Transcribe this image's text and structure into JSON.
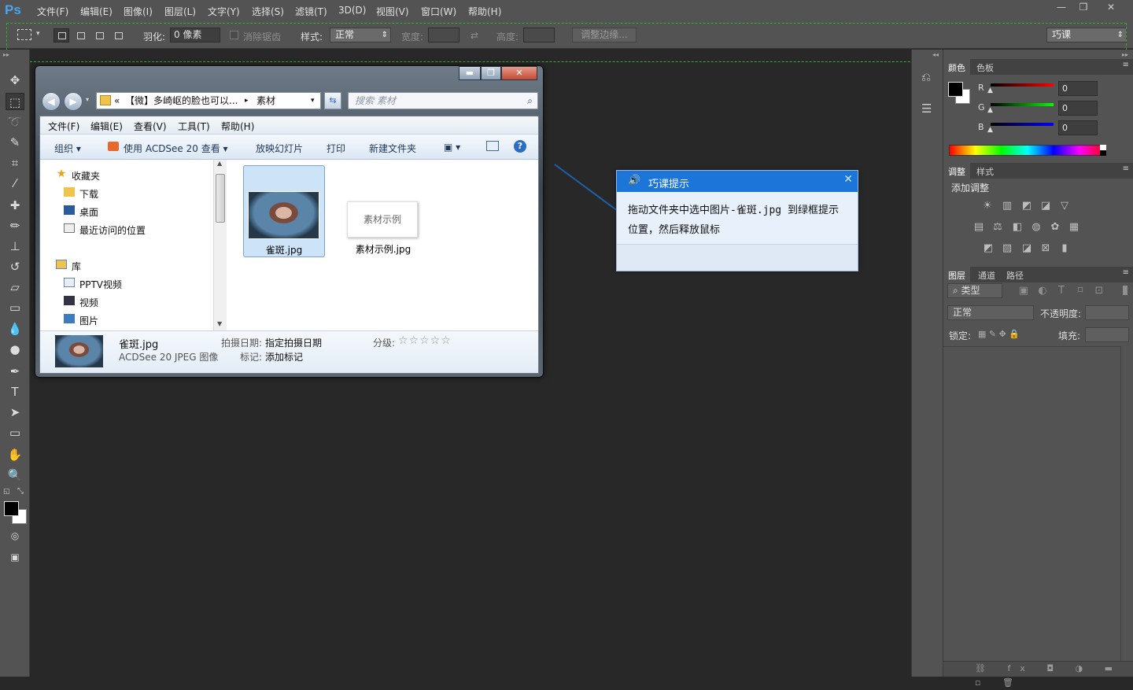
{
  "app": {
    "logo": "Ps"
  },
  "menu": [
    "文件(F)",
    "编辑(E)",
    "图像(I)",
    "图层(L)",
    "文字(Y)",
    "选择(S)",
    "滤镜(T)",
    "3D(D)",
    "视图(V)",
    "窗口(W)",
    "帮助(H)"
  ],
  "options": {
    "feather_label": "羽化:",
    "feather_value": "0 像素",
    "antialias_label": "消除锯齿",
    "style_label": "样式:",
    "style_value": "正常",
    "width_label": "宽度:",
    "height_label": "高度:",
    "refine_edge": "调整边缘...",
    "workspace": "巧课"
  },
  "explorer": {
    "address_prefix": "«",
    "address_path": "【微】多崎岖的脸也可以...",
    "address_sep": "▸",
    "address_current": "素材",
    "search_placeholder": "搜索 素材",
    "menu": [
      "文件(F)",
      "编辑(E)",
      "查看(V)",
      "工具(T)",
      "帮助(H)"
    ],
    "commands": {
      "organize": "组织 ▾",
      "open_with": "使用 ACDSee 20 查看 ▾",
      "slideshow": "放映幻灯片",
      "print": "打印",
      "new_folder": "新建文件夹"
    },
    "nav": {
      "favorites": "收藏夹",
      "downloads": "下载",
      "desktop": "桌面",
      "recent": "最近访问的位置",
      "libraries": "库",
      "pptv": "PPTV视频",
      "videos": "视频",
      "pictures": "图片"
    },
    "files": [
      {
        "name": "雀斑.jpg"
      },
      {
        "name": "素材示例.jpg",
        "thumb_text": "素材示例"
      }
    ],
    "details": {
      "filename": "雀斑.jpg",
      "filetype": "ACDSee 20 JPEG 图像",
      "date_label": "拍摄日期:",
      "date_value": "指定拍摄日期",
      "tags_label": "标记:",
      "tags_value": "添加标记",
      "rating_label": "分级:",
      "rating_stars": "☆☆☆☆☆",
      "rating": 0
    }
  },
  "tip": {
    "title": "巧课提示",
    "body": "拖动文件夹中选中图片-雀斑.jpg 到绿框提示位置，然后释放鼠标"
  },
  "panels": {
    "color_tabs": [
      "颜色",
      "色板"
    ],
    "rgb": [
      {
        "label": "R",
        "value": "0"
      },
      {
        "label": "G",
        "value": "0"
      },
      {
        "label": "B",
        "value": "0"
      }
    ],
    "adjust_tabs": [
      "调整",
      "样式"
    ],
    "adjust_title": "添加调整",
    "layers_tabs": [
      "图层",
      "通道",
      "路径"
    ],
    "layer_filter": "类型",
    "blend_mode": "正常",
    "opacity_label": "不透明度:",
    "lock_label": "锁定:",
    "fill_label": "填充:"
  },
  "colors": {
    "accent": "#1c75d8",
    "guide": "#2ab32a"
  }
}
